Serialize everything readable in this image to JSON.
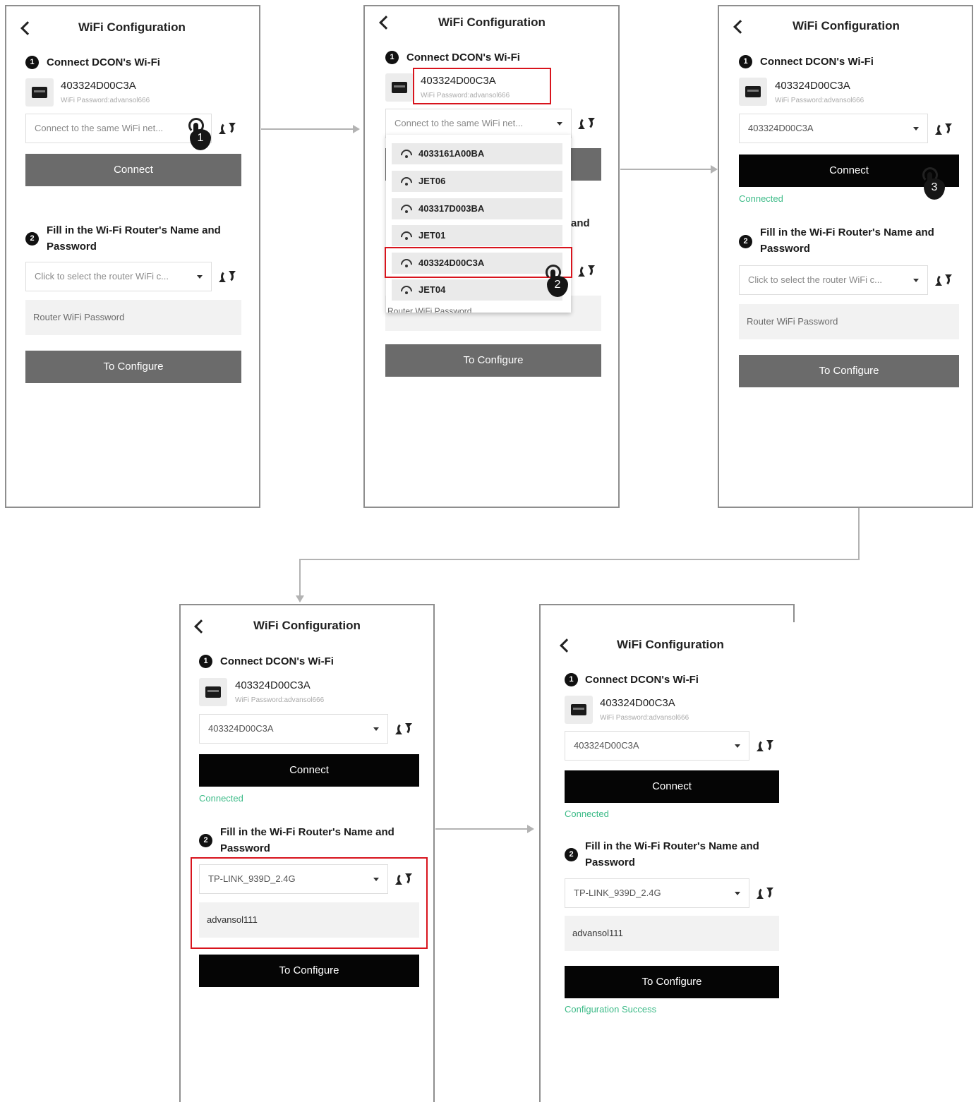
{
  "screen": {
    "title": "WiFi Configuration",
    "step1_num": "1",
    "step2_num": "2",
    "step1_title": "Connect DCON's Wi-Fi",
    "step2_title_line1": "Fill in the Wi-Fi Router's Name and",
    "step2_title_line2": "Password",
    "device_name": "403324D00C3A",
    "device_password": "WiFi Password:advansol666",
    "dcon_wifi_placeholder": "Connect to the same WiFi net...",
    "router_wifi_placeholder": "Click to select the router WiFi c...",
    "router_password_placeholder": "Router WiFi Password",
    "connect_label": "Connect",
    "configure_label": "To Configure",
    "status_connected": "Connected",
    "status_config_success": "Configuration Success",
    "selected_dcon_wifi": "403324D00C3A",
    "selected_router_wifi": "TP-LINK_939D_2.4G",
    "router_password_value": "advansol111"
  },
  "dropdown": {
    "items": [
      "4033161A00BA",
      "JET06",
      "403317D003BA",
      "JET01",
      "403324D00C3A",
      "JET04"
    ],
    "peek_text": "and",
    "obscured_text": "Router WiFi Password"
  },
  "steps": {
    "click1": "1",
    "click2": "2",
    "click3": "3"
  },
  "colors": {
    "button_disabled": "#6b6b6b",
    "button_active": "#050505",
    "status_green": "#3dbb88",
    "highlight_red": "#d8141d"
  }
}
